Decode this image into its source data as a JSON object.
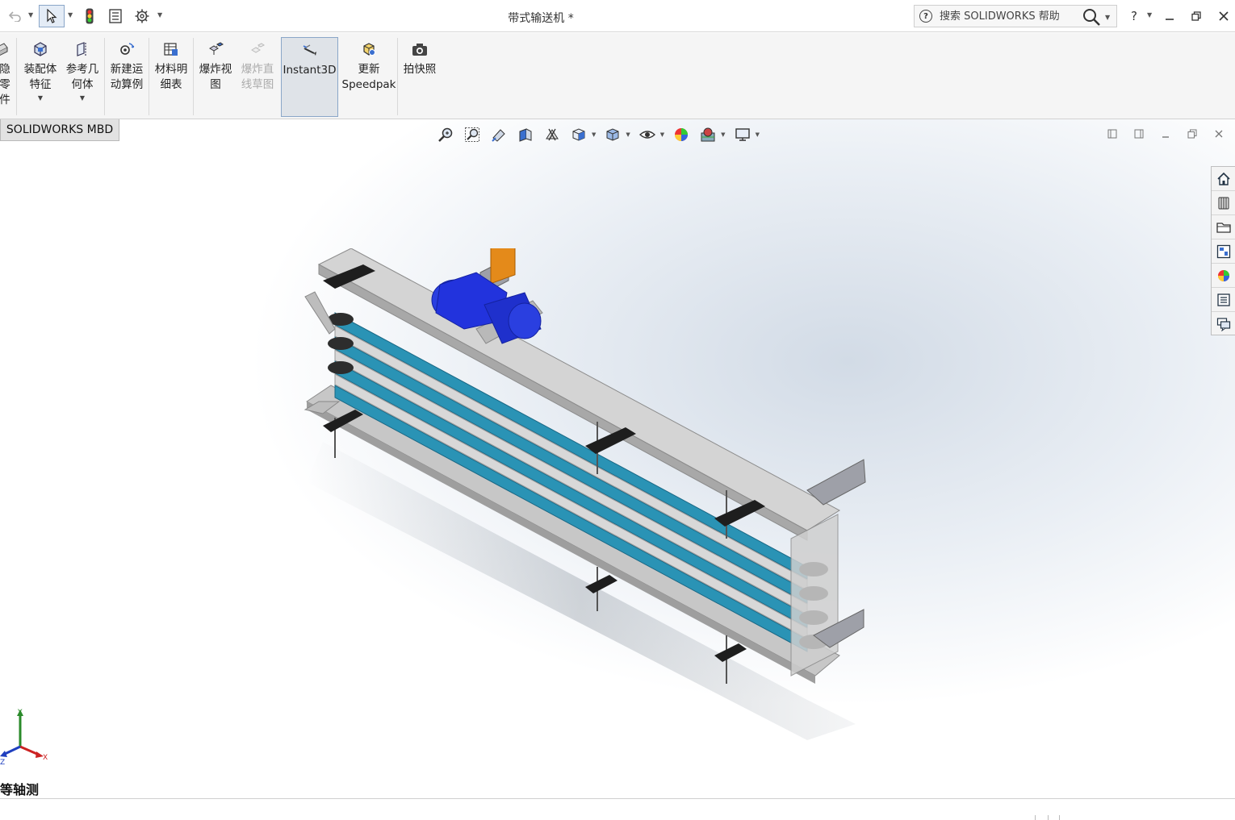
{
  "titlebar": {
    "document_title": "带式输送机 *",
    "search_placeholder": "搜索 SOLIDWORKS 帮助",
    "help_glyph": "?",
    "help_badge": "?"
  },
  "ribbon": {
    "items": [
      {
        "label": "隐\n零\n件",
        "enabled": true
      },
      {
        "label": "装配体\n特征",
        "enabled": true,
        "dropdown": true
      },
      {
        "label": "参考几\n何体",
        "enabled": true,
        "dropdown": true
      },
      {
        "label": "新建运\n动算例",
        "enabled": true
      },
      {
        "label": "材料明\n细表",
        "enabled": true
      },
      {
        "label": "爆炸视\n图",
        "enabled": true
      },
      {
        "label": "爆炸直\n线草图",
        "enabled": false
      },
      {
        "label": "Instant3D",
        "enabled": true,
        "active": true
      },
      {
        "label": "更新\nSpeedpak",
        "enabled": true
      },
      {
        "label": "拍快照",
        "enabled": true
      }
    ]
  },
  "tabs": {
    "active_tab": "SOLIDWORKS MBD"
  },
  "viewport": {
    "view_orientation": "等轴测",
    "triad": {
      "x": "X",
      "y": "Y",
      "z": "Z"
    }
  },
  "colors": {
    "accent": "#1f5fbf",
    "belt": "#2a93b5",
    "frame": "#c9c9c9",
    "motor": "#2233dd",
    "bracket": "#e48a1a"
  }
}
